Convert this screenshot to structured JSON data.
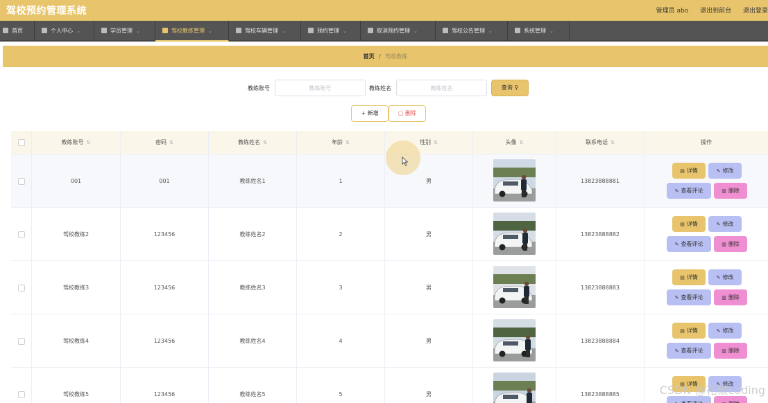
{
  "app": {
    "title": "驾校预约管理系统",
    "user_label": "管理员 abo",
    "to_front_label": "退出到前台",
    "logout_label": "退出登录"
  },
  "nav": {
    "items": [
      {
        "label": "首页",
        "has_chevron": false
      },
      {
        "label": "个人中心",
        "has_chevron": true
      },
      {
        "label": "学员管理",
        "has_chevron": true
      },
      {
        "label": "驾校教练管理",
        "has_chevron": true,
        "active": true
      },
      {
        "label": "驾校车辆管理",
        "has_chevron": true
      },
      {
        "label": "预约管理",
        "has_chevron": true
      },
      {
        "label": "取消预约管理",
        "has_chevron": true
      },
      {
        "label": "驾校公告管理",
        "has_chevron": true
      },
      {
        "label": "系统管理",
        "has_chevron": true
      }
    ]
  },
  "breadcrumb": {
    "home": "首页",
    "separator": "/",
    "current": "驾校教练"
  },
  "search": {
    "account_label": "教练账号",
    "account_placeholder": "教练账号",
    "name_label": "教练姓名",
    "name_placeholder": "教练姓名",
    "query_label": "查询"
  },
  "actions": {
    "add_label": "新增",
    "delete_label": "删除"
  },
  "table": {
    "columns": [
      "教练账号",
      "密码",
      "教练姓名",
      "年龄",
      "性别",
      "头像",
      "联系电话",
      "操作"
    ],
    "rows": [
      {
        "account": "001",
        "password": "001",
        "name": "教练姓名1",
        "age": "1",
        "gender": "男",
        "phone": "13823888881"
      },
      {
        "account": "驾校教练2",
        "password": "123456",
        "name": "教练姓名2",
        "age": "2",
        "gender": "男",
        "phone": "13823888882"
      },
      {
        "account": "驾校教练3",
        "password": "123456",
        "name": "教练姓名3",
        "age": "3",
        "gender": "男",
        "phone": "13823888883"
      },
      {
        "account": "驾校教练4",
        "password": "123456",
        "name": "教练姓名4",
        "age": "4",
        "gender": "男",
        "phone": "13823888884"
      },
      {
        "account": "驾校教练5",
        "password": "123456",
        "name": "教练姓名5",
        "age": "5",
        "gender": "男",
        "phone": "13823888885"
      }
    ],
    "row_buttons": {
      "detail": "详情",
      "edit": "修改",
      "review": "查看评论",
      "delete": "删除"
    }
  },
  "watermark": "CSDN @花椒coding",
  "colors": {
    "accent": "#e8c56c",
    "nav_bg": "#545454",
    "edit_btn": "#b8bff2",
    "delete_btn": "#f08ed2"
  }
}
